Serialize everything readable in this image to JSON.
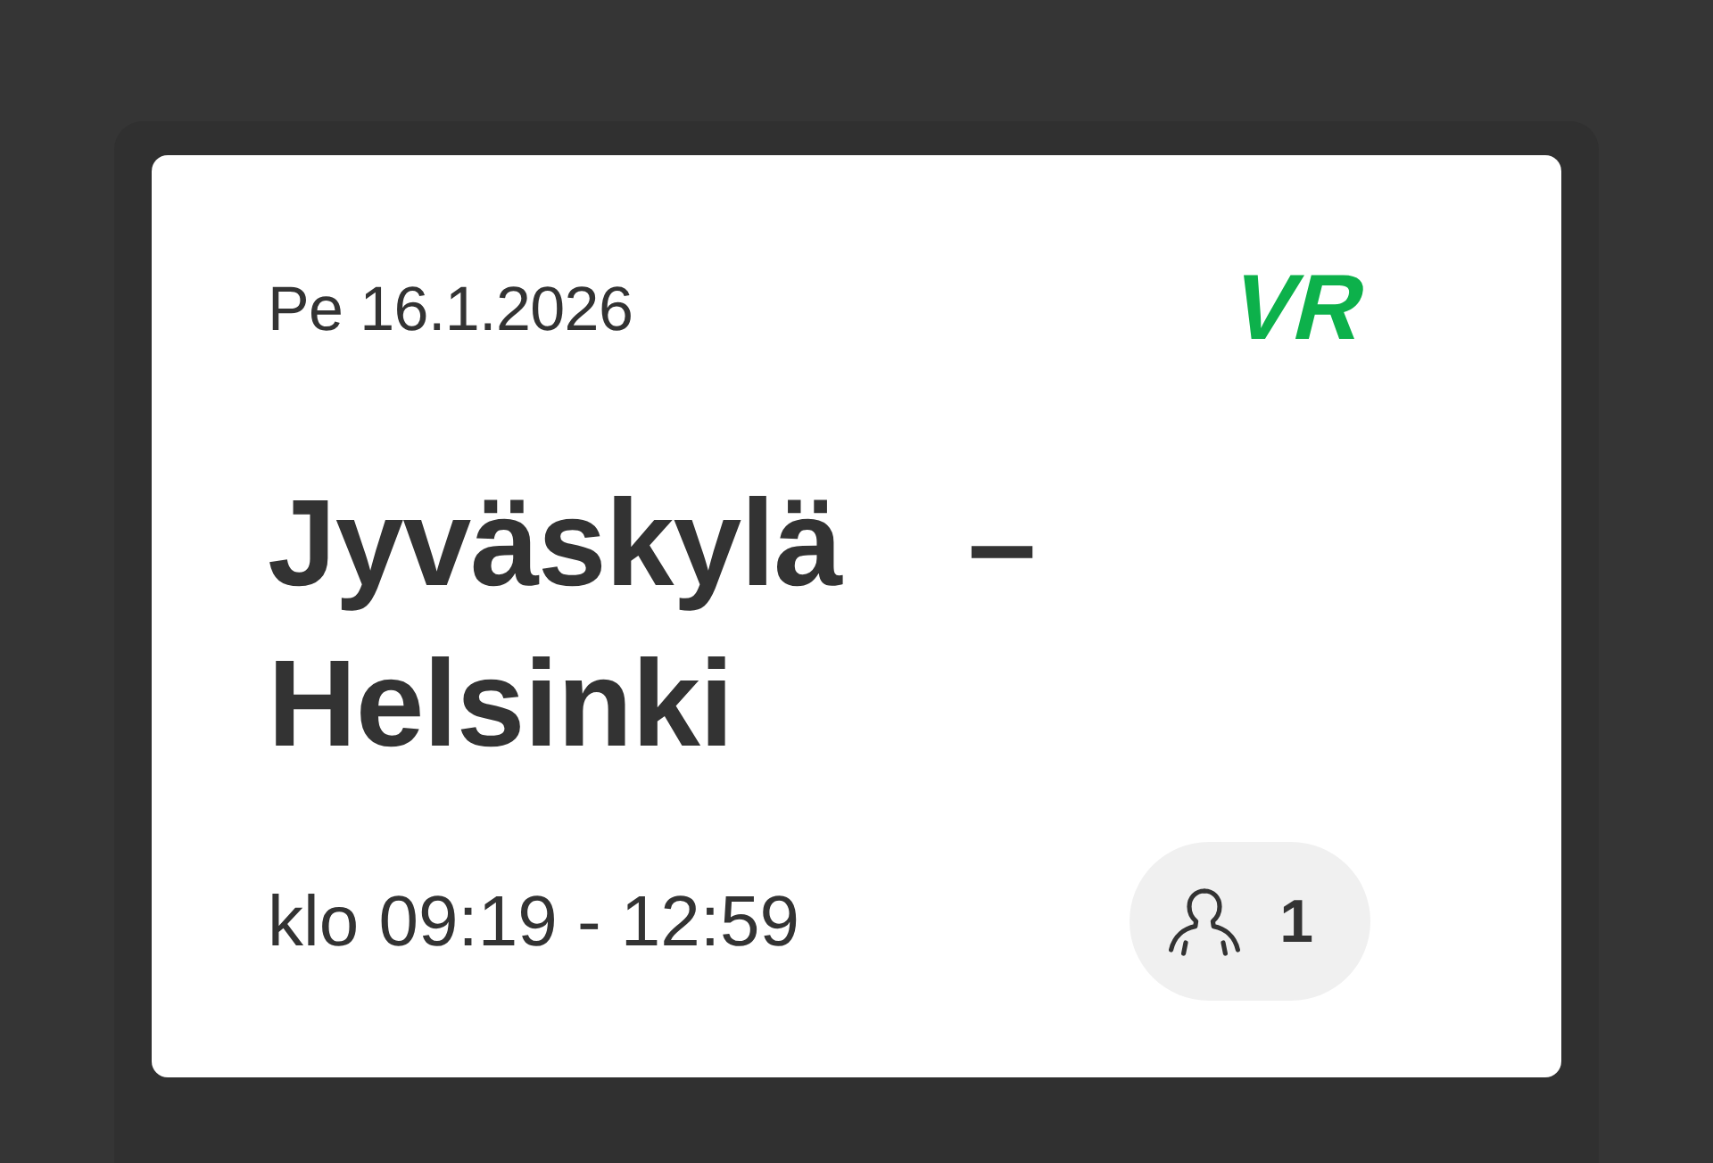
{
  "ticket": {
    "date": "Pe 16.1.2026",
    "logo": "VR",
    "route": "Jyväskylä – Helsinki",
    "time": "klo 09:19 - 12:59",
    "passengers": "1"
  }
}
